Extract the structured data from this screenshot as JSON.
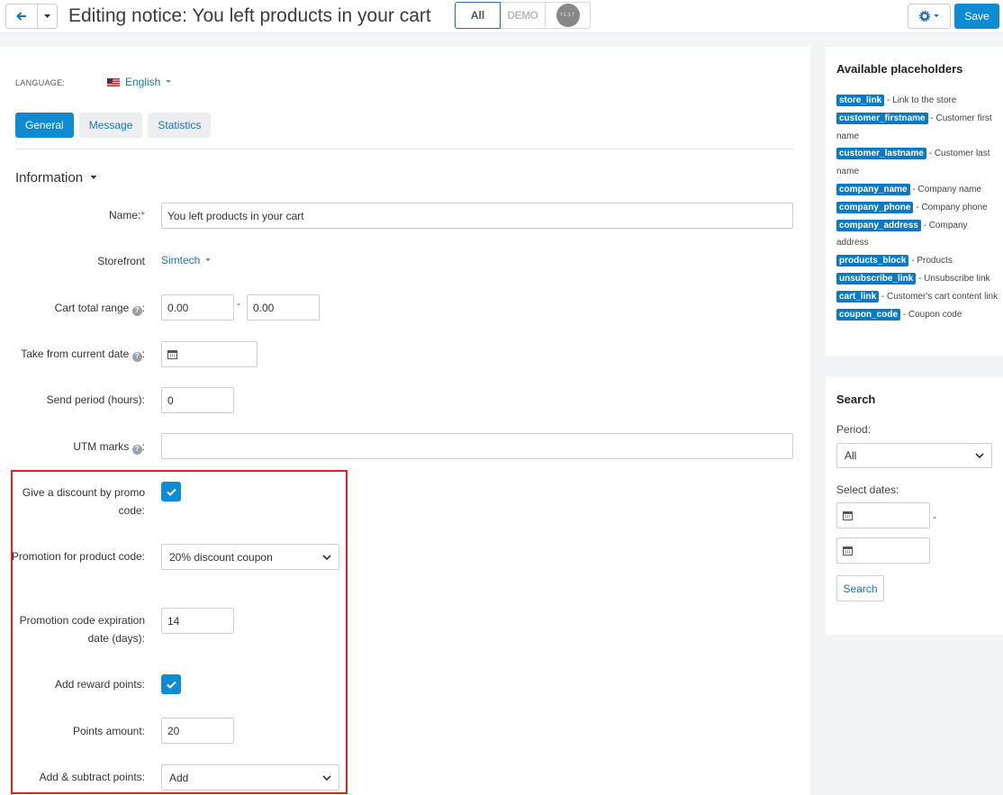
{
  "header": {
    "title": "Editing notice: You left products in your cart",
    "storefronts": {
      "all": "All",
      "demo": "DEMO",
      "test": "TEST"
    },
    "save_label": "Save"
  },
  "language": {
    "label": "LANGUAGE:",
    "value": "English"
  },
  "tabs": [
    {
      "label": "General",
      "active": true
    },
    {
      "label": "Message",
      "active": false
    },
    {
      "label": "Statistics",
      "active": false
    }
  ],
  "section": {
    "title": "Information"
  },
  "form": {
    "name": {
      "label": "Name:",
      "required_mark": "*",
      "value": "You left products in your cart"
    },
    "storefront": {
      "label": "Storefront",
      "value": "Simtech"
    },
    "cart_total_range": {
      "label": "Cart total range",
      "from": "0.00",
      "separator": "-",
      "to": "0.00"
    },
    "take_from_current_date": {
      "label": "Take from current date"
    },
    "send_period": {
      "label": "Send period (hours):",
      "value": "0"
    },
    "utm_marks": {
      "label": "UTM marks",
      "value": ""
    },
    "give_discount": {
      "label": "Give a discount by promo code:",
      "checked": true
    },
    "promotion_for_code": {
      "label": "Promotion for product code:",
      "value": "20% discount coupon"
    },
    "promo_expiration": {
      "label": "Promotion code expiration date (days):",
      "value": "14"
    },
    "add_reward_points": {
      "label": "Add reward points:",
      "checked": true
    },
    "points_amount": {
      "label": "Points amount:",
      "value": "20"
    },
    "add_subtract_points": {
      "label": "Add & subtract points:",
      "value": "Add"
    }
  },
  "placeholders": {
    "title": "Available placeholders",
    "items": [
      {
        "tag": "store_link",
        "desc": " - Link to the store"
      },
      {
        "tag": "customer_firstname",
        "desc": " - Customer first name"
      },
      {
        "tag": "customer_lastname",
        "desc": " - Customer last name"
      },
      {
        "tag": "company_name",
        "desc": " - Company name"
      },
      {
        "tag": "company_phone",
        "desc": " - Company phone"
      },
      {
        "tag": "company_address",
        "desc": " - Company address"
      },
      {
        "tag": "products_block",
        "desc": " - Products"
      },
      {
        "tag": "unsubscribe_link",
        "desc": " - Unsubscribe link"
      },
      {
        "tag": "cart_link",
        "desc": " - Customer's cart content link"
      },
      {
        "tag": "coupon_code",
        "desc": " - Coupon code"
      }
    ]
  },
  "search": {
    "title": "Search",
    "period_label": "Period:",
    "period_value": "All",
    "select_dates_label": "Select dates:",
    "date_separator": "-",
    "button_label": "Search"
  },
  "icons": {
    "back": "arrow-left-icon",
    "caret": "chevron-down-icon",
    "gear": "gear-icon",
    "calendar": "calendar-icon",
    "check": "check-icon",
    "help": "question-circle-icon"
  },
  "colors": {
    "accent": "#0f8bd4",
    "link": "#1a73c0",
    "highlight": "#e02020"
  }
}
